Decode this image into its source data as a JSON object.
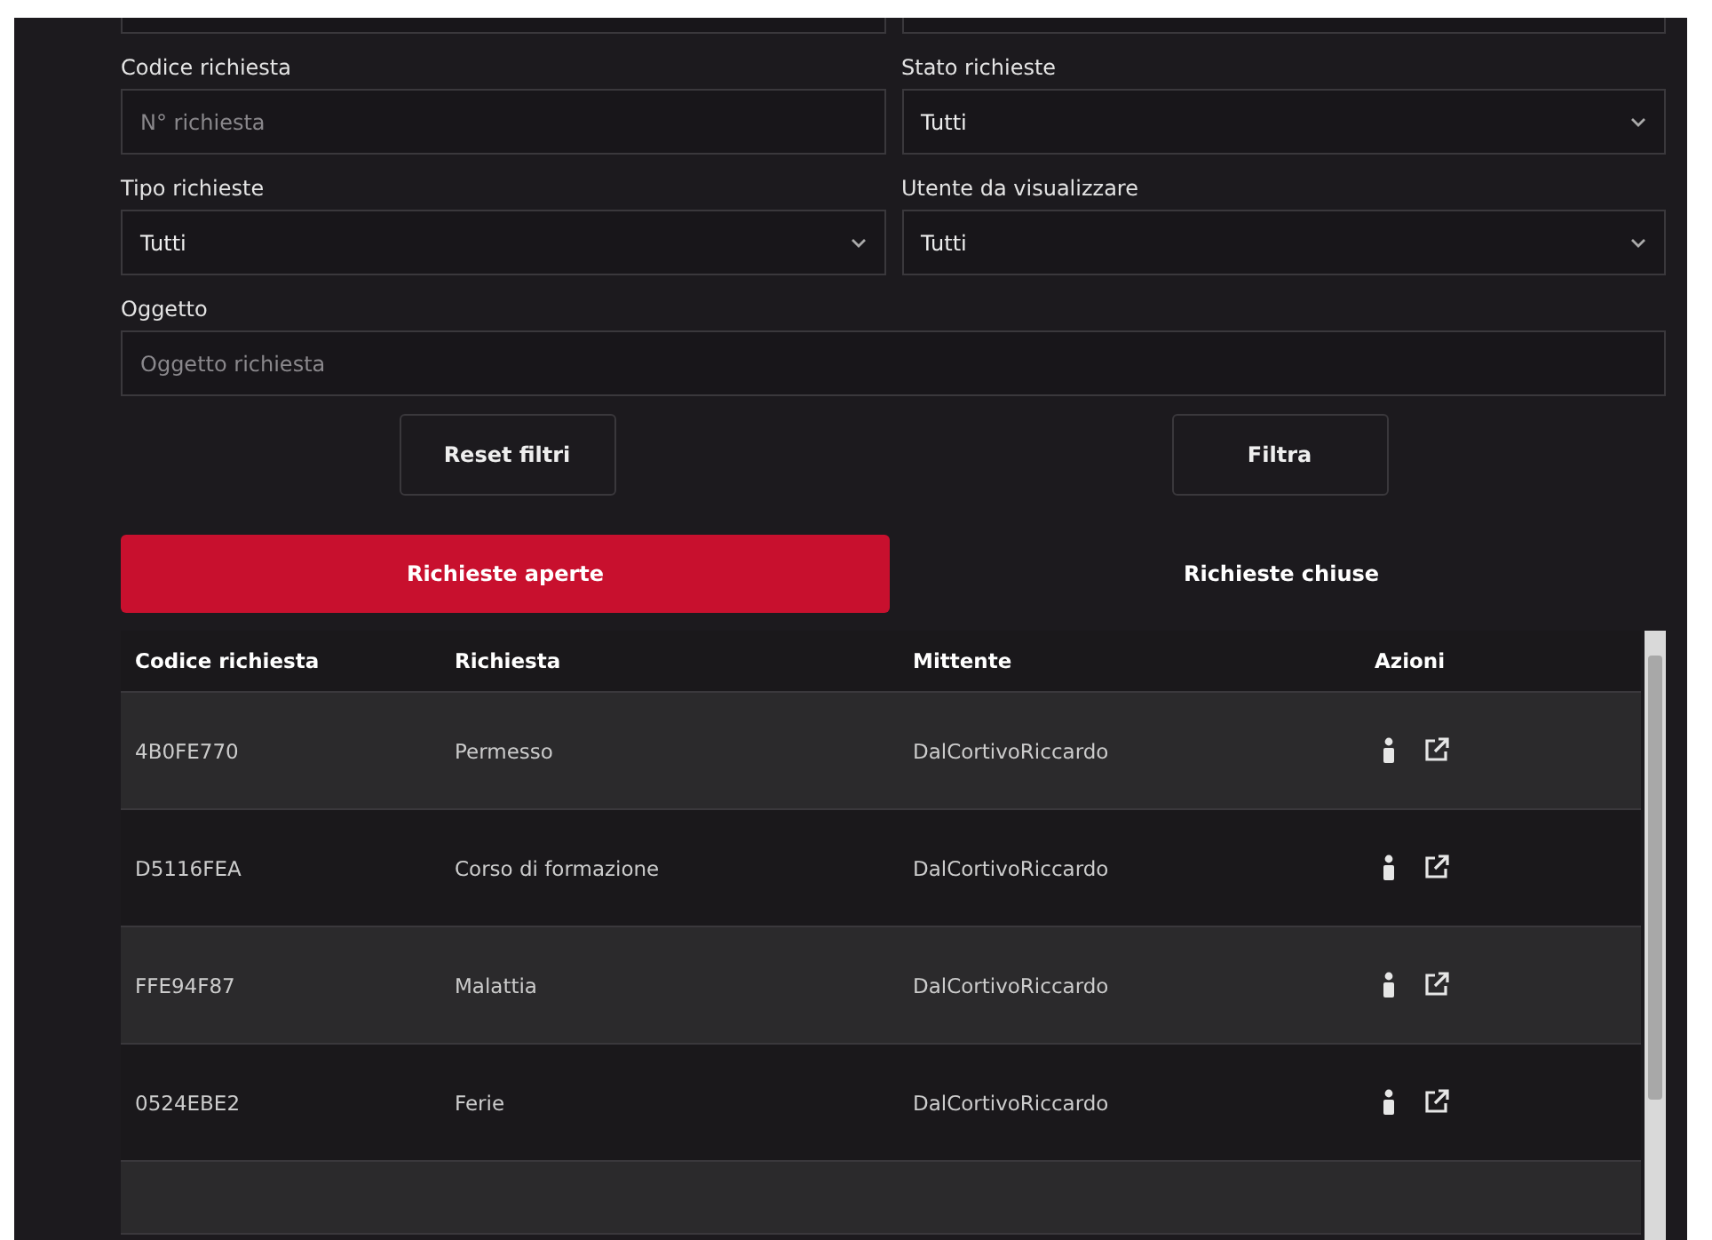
{
  "filters": [
    {
      "label": "Codice richiesta",
      "kind": "input",
      "placeholder": "N° richiesta"
    },
    {
      "label": "Stato richieste",
      "kind": "select",
      "value": "Tutti"
    },
    {
      "label": "Tipo richieste",
      "kind": "select",
      "value": "Tutti"
    },
    {
      "label": "Utente da visualizzare",
      "kind": "select",
      "value": "Tutti"
    },
    {
      "label": "Oggetto",
      "kind": "input",
      "placeholder": "Oggetto richiesta",
      "wide": true
    }
  ],
  "buttons": [
    "Reset filtri",
    "Filtra"
  ],
  "tabs": [
    {
      "label": "Richieste aperte",
      "selected": true
    },
    {
      "label": "Richieste chiuse",
      "selected": false
    }
  ],
  "table": {
    "columns": [
      "Codice richiesta",
      "Richiesta",
      "Mittente",
      "Azioni"
    ],
    "rows": [
      {
        "code": "4B0FE770",
        "request": "Permesso",
        "sender": "DalCortivoRiccardo"
      },
      {
        "code": "D5116FEA",
        "request": "Corso di formazione",
        "sender": "DalCortivoRiccardo"
      },
      {
        "code": "FFE94F87",
        "request": "Malattia",
        "sender": "DalCortivoRiccardo"
      },
      {
        "code": "0524EBE2",
        "request": "Ferie",
        "sender": "DalCortivoRiccardo"
      }
    ]
  }
}
